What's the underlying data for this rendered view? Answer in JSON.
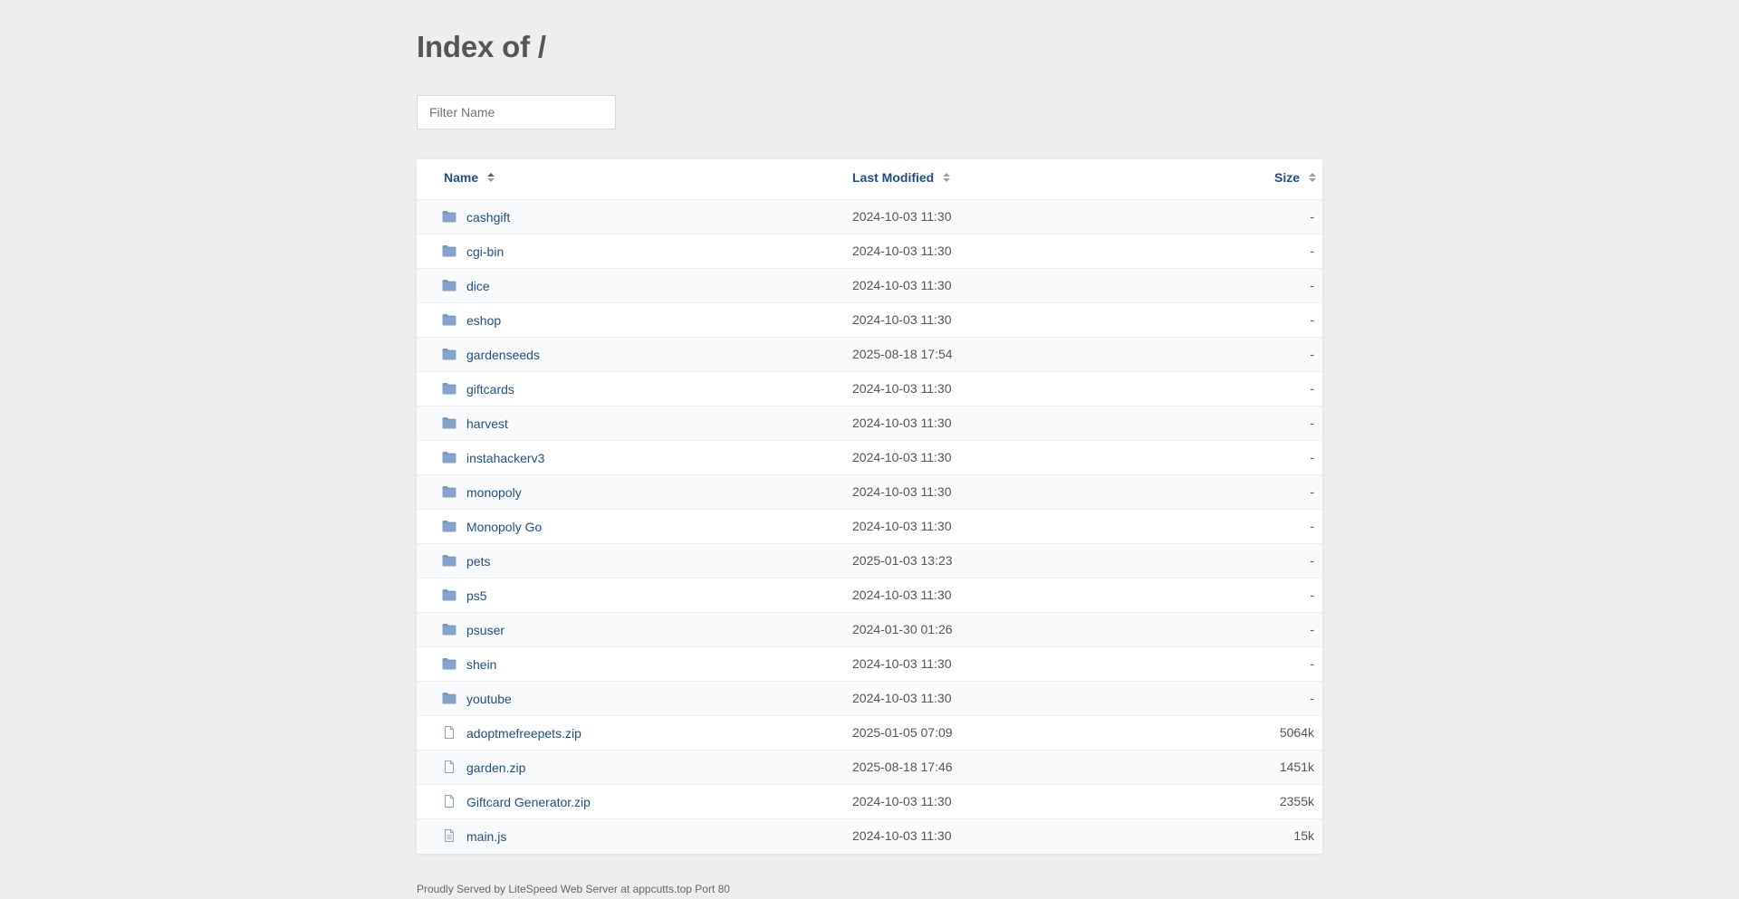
{
  "page": {
    "title": "Index of /"
  },
  "filter": {
    "placeholder": "Filter Name",
    "value": ""
  },
  "columns": {
    "name": "Name",
    "last_modified": "Last Modified",
    "size": "Size"
  },
  "entries": [
    {
      "type": "folder",
      "name": "cashgift",
      "modified": "2024-10-03 11:30",
      "size": "-"
    },
    {
      "type": "folder",
      "name": "cgi-bin",
      "modified": "2024-10-03 11:30",
      "size": "-"
    },
    {
      "type": "folder",
      "name": "dice",
      "modified": "2024-10-03 11:30",
      "size": "-"
    },
    {
      "type": "folder",
      "name": "eshop",
      "modified": "2024-10-03 11:30",
      "size": "-"
    },
    {
      "type": "folder",
      "name": "gardenseeds",
      "modified": "2025-08-18 17:54",
      "size": "-"
    },
    {
      "type": "folder",
      "name": "giftcards",
      "modified": "2024-10-03 11:30",
      "size": "-"
    },
    {
      "type": "folder",
      "name": "harvest",
      "modified": "2024-10-03 11:30",
      "size": "-"
    },
    {
      "type": "folder",
      "name": "instahackerv3",
      "modified": "2024-10-03 11:30",
      "size": "-"
    },
    {
      "type": "folder",
      "name": "monopoly",
      "modified": "2024-10-03 11:30",
      "size": "-"
    },
    {
      "type": "folder",
      "name": "Monopoly Go",
      "modified": "2024-10-03 11:30",
      "size": "-"
    },
    {
      "type": "folder",
      "name": "pets",
      "modified": "2025-01-03 13:23",
      "size": "-"
    },
    {
      "type": "folder",
      "name": "ps5",
      "modified": "2024-10-03 11:30",
      "size": "-"
    },
    {
      "type": "folder",
      "name": "psuser",
      "modified": "2024-01-30 01:26",
      "size": "-"
    },
    {
      "type": "folder",
      "name": "shein",
      "modified": "2024-10-03 11:30",
      "size": "-"
    },
    {
      "type": "folder",
      "name": "youtube",
      "modified": "2024-10-03 11:30",
      "size": "-"
    },
    {
      "type": "file",
      "name": "adoptmefreepets.zip",
      "modified": "2025-01-05 07:09",
      "size": "5064k"
    },
    {
      "type": "file",
      "name": "garden.zip",
      "modified": "2025-08-18 17:46",
      "size": "1451k"
    },
    {
      "type": "file",
      "name": "Giftcard Generator.zip",
      "modified": "2024-10-03 11:30",
      "size": "2355k"
    },
    {
      "type": "text-file",
      "name": "main.js",
      "modified": "2024-10-03 11:30",
      "size": "15k"
    }
  ],
  "icons": {
    "folder": "folder-icon",
    "file": "file-icon",
    "text-file": "text-file-icon"
  },
  "colors": {
    "background": "#edeef0",
    "link": "#1f4f88",
    "folder": "#7a99c4"
  },
  "footer": {
    "text": "Proudly Served by LiteSpeed Web Server at appcutts.top Port 80"
  }
}
